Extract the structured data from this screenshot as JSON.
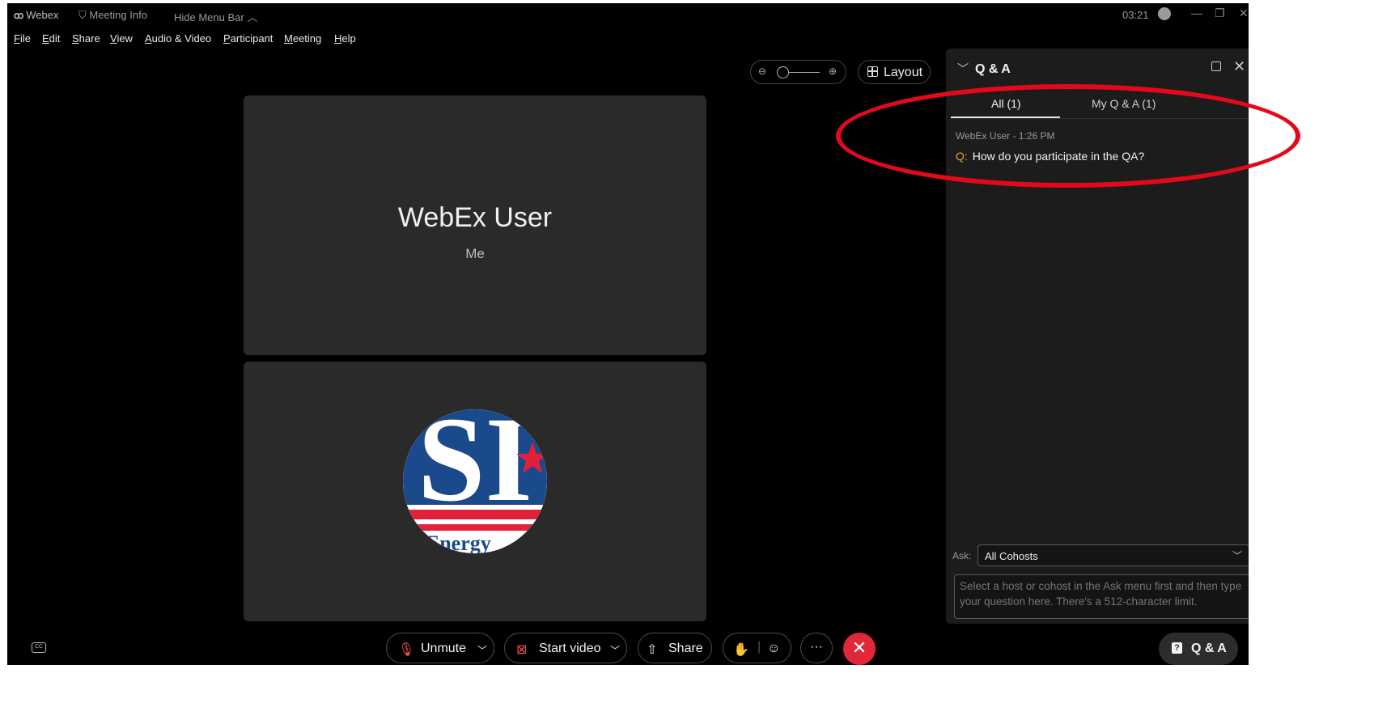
{
  "titlebar": {
    "app_name": "Webex",
    "meeting_info": "Meeting Info",
    "hide_menu_bar": "Hide Menu Bar",
    "time": "03:21"
  },
  "menu": [
    "File",
    "Edit",
    "Share",
    "View",
    "Audio & Video",
    "Participant",
    "Meeting",
    "Help"
  ],
  "controls": {
    "layout_label": "Layout"
  },
  "tiles": {
    "self_name": "WebEx User",
    "self_sub": "Me"
  },
  "avatar_text": "s Energy",
  "toolbar": {
    "unmute": "Unmute",
    "start_video": "Start video",
    "share": "Share",
    "more": "···",
    "qa": "Q & A"
  },
  "qa": {
    "title": "Q & A",
    "tabs": [
      "All (1)",
      "My Q & A (1)"
    ],
    "question": {
      "meta": "WebEx User - 1:26 PM",
      "prefix": "Q:",
      "text": "How do you participate in the QA?"
    },
    "ask_label": "Ask:",
    "ask_value": "All Cohosts",
    "input_placeholder": "Select a host or cohost in the Ask menu first and then type your question here. There's a 512-character limit."
  },
  "colors": {
    "accent_end": "#e0283a",
    "annotation": "#e3091b",
    "question_prefix": "#f0a030"
  }
}
